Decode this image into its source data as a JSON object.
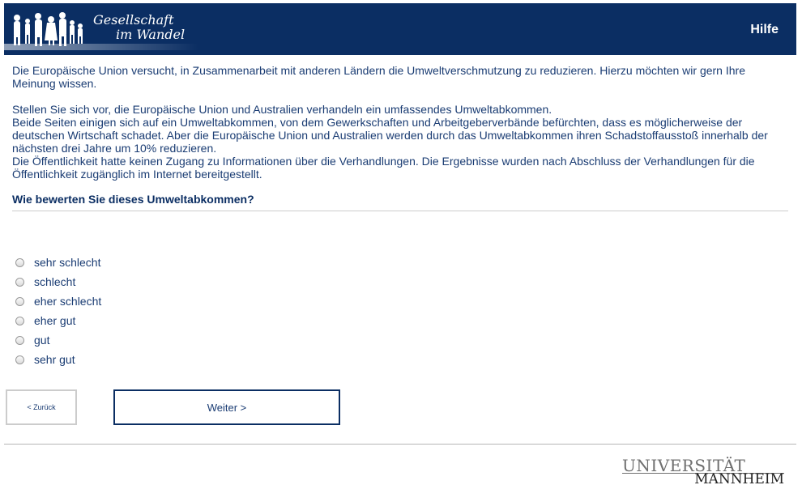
{
  "header": {
    "logo_line1": "Gesellschaft",
    "logo_line2": "im Wandel",
    "help_label": "Hilfe"
  },
  "intro": {
    "p1": "Die Europäische Union versucht, in Zusammenarbeit mit anderen Ländern die Umweltverschmutzung zu reduzieren. Hierzu möchten wir gern Ihre Meinung wissen.",
    "p2_line1": "Stellen Sie sich vor, die Europäische Union und Australien verhandeln ein umfassendes Umweltabkommen.",
    "p2_line2": "Beide Seiten einigen sich auf ein Umweltabkommen, von dem Gewerkschaften und Arbeitgeberverbände befürchten, dass es möglicherweise der deutschen Wirtschaft schadet. Aber die Europäische Union und Australien werden durch das Umweltabkommen ihren Schadstoffausstoß innerhalb der nächsten drei Jahre um 10% reduzieren.",
    "p2_line3": "Die Öffentlichkeit hatte keinen Zugang zu Informationen über die Verhandlungen. Die Ergebnisse wurden nach Abschluss der Verhandlungen für die Öffentlichkeit zugänglich im Internet bereitgestellt."
  },
  "question": "Wie bewerten Sie dieses Umweltabkommen?",
  "options": [
    "sehr schlecht",
    "schlecht",
    "eher schlecht",
    "eher gut",
    "gut",
    "sehr gut"
  ],
  "nav": {
    "back_label": "< Zurück",
    "next_label": "Weiter >"
  },
  "footer": {
    "logo_line1": "UNIVERSITÄT",
    "logo_line2": "MANNHEIM"
  },
  "colors": {
    "header_bg": "#0b2e63",
    "text": "#1a3c73"
  }
}
